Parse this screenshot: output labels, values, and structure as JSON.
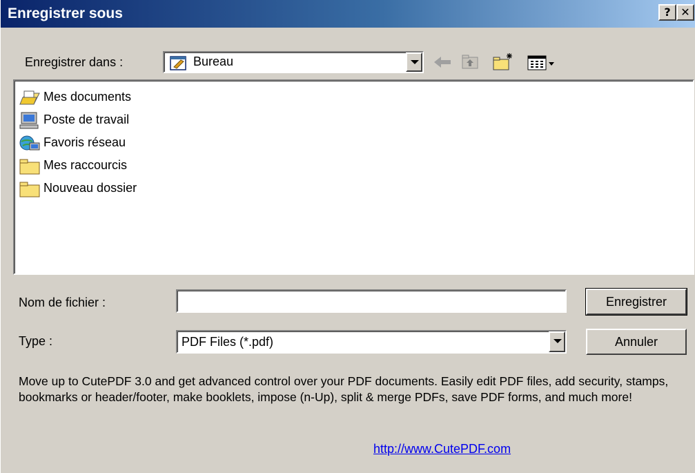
{
  "window": {
    "title": "Enregistrer sous",
    "help_glyph": "?",
    "close_glyph": "✕"
  },
  "save_in": {
    "label": "Enregistrer dans :",
    "value": "Bureau"
  },
  "toolbar": {
    "icons": [
      "back-arrow-icon",
      "up-folder-icon",
      "new-folder-icon",
      "view-menu-icon"
    ]
  },
  "files": [
    {
      "label": "Mes documents",
      "icon": "my-documents-icon"
    },
    {
      "label": "Poste de travail",
      "icon": "my-computer-icon"
    },
    {
      "label": "Favoris réseau",
      "icon": "network-places-icon"
    },
    {
      "label": "Mes raccourcis",
      "icon": "folder-icon"
    },
    {
      "label": "Nouveau dossier",
      "icon": "folder-icon"
    }
  ],
  "filename": {
    "label": "Nom de fichier :",
    "value": ""
  },
  "filetype": {
    "label": "Type :",
    "value": "PDF Files (*.pdf)"
  },
  "buttons": {
    "save": "Enregistrer",
    "cancel": "Annuler"
  },
  "promo": {
    "text": "Move up to CutePDF 3.0 and get advanced control over your PDF documents. Easily edit PDF files, add security, stamps, bookmarks or header/footer, make booklets, impose (n-Up), split & merge PDFs, save PDF forms, and much more!",
    "link": "http://www.CutePDF.com"
  },
  "colors": {
    "face": "#d4d0c8",
    "title_start": "#0a246a",
    "title_end": "#a6caf0",
    "link": "#0000ee"
  }
}
